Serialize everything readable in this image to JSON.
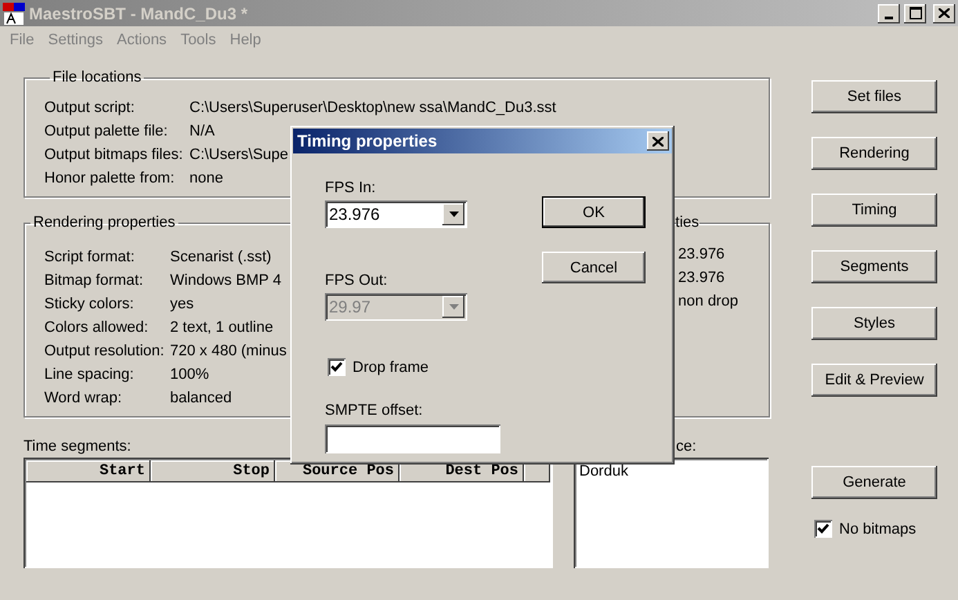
{
  "window": {
    "title": "MaestroSBT - MandC_Du3 *",
    "active": false
  },
  "menu": [
    {
      "label": "File",
      "disabled": true
    },
    {
      "label": "Settings",
      "disabled": true
    },
    {
      "label": "Actions",
      "disabled": true
    },
    {
      "label": "Tools",
      "disabled": true
    },
    {
      "label": "Help",
      "disabled": true
    }
  ],
  "file_locations": {
    "title": "File locations",
    "rows": [
      {
        "label": "Output script:",
        "value": "C:\\Users\\Superuser\\Desktop\\new ssa\\MandC_Du3.sst"
      },
      {
        "label": "Output palette file:",
        "value": "N/A"
      },
      {
        "label": "Output bitmaps files:",
        "value": "C:\\Users\\Supe"
      },
      {
        "label": "Honor palette from:",
        "value": "none"
      }
    ]
  },
  "rendering_properties": {
    "title": "Rendering properties",
    "rows": [
      {
        "label": "Script format:",
        "value": "Scenarist (.sst)"
      },
      {
        "label": "Bitmap format:",
        "value": "Windows BMP 4"
      },
      {
        "label": "Sticky colors:",
        "value": "yes"
      },
      {
        "label": "Colors allowed:",
        "value": "2 text, 1 outline"
      },
      {
        "label": "Output resolution:",
        "value": "720 x 480 (minus"
      },
      {
        "label": "Line spacing:",
        "value": "100%"
      },
      {
        "label": "Word wrap:",
        "value": "balanced"
      }
    ]
  },
  "timing_group": {
    "title": "ties",
    "values": [
      "23.976",
      "23.976",
      "non drop"
    ]
  },
  "time_segments": {
    "label": "Time segments:",
    "columns": [
      "Start",
      "Stop",
      "Source Pos",
      "Dest Pos"
    ]
  },
  "source_list": {
    "label": "ce:",
    "items": [
      "Dorduk"
    ]
  },
  "buttons": [
    {
      "label": "Set files"
    },
    {
      "label": "Rendering"
    },
    {
      "label": "Timing"
    },
    {
      "label": "Segments"
    },
    {
      "label": "Styles"
    },
    {
      "label": "Edit & Preview"
    }
  ],
  "generate_button": {
    "label": "Generate"
  },
  "no_bitmaps": {
    "label": "No bitmaps",
    "checked": true
  },
  "dialog": {
    "title": "Timing properties",
    "fps_in": {
      "label": "FPS In:",
      "value": "23.976",
      "disabled": false
    },
    "fps_out": {
      "label": "FPS Out:",
      "value": "29.97",
      "disabled": true
    },
    "drop_frame": {
      "label": "Drop frame",
      "checked": true
    },
    "smpte": {
      "label": "SMPTE offset:"
    },
    "buttons": [
      {
        "label": "OK",
        "default": true
      },
      {
        "label": "Cancel",
        "default": false
      }
    ]
  }
}
